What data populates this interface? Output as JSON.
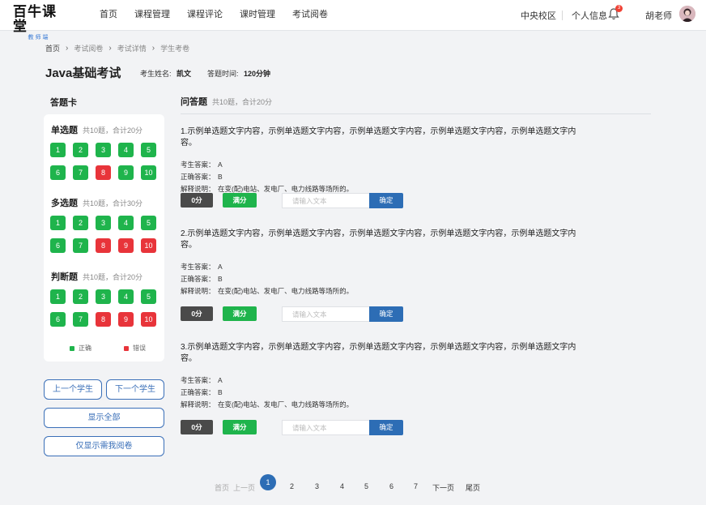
{
  "header": {
    "logo_main": "百牛课堂",
    "logo_sub": "教师端",
    "nav": [
      "首页",
      "课程管理",
      "课程评论",
      "课时管理",
      "考试阅卷"
    ],
    "campus": "中央校区",
    "profile": "个人信息",
    "notification_count": "3",
    "teacher": "胡老师"
  },
  "breadcrumb": [
    "首页",
    "考试阅卷",
    "考试详情",
    "学生考卷"
  ],
  "exam": {
    "title": "Java基础考试",
    "student_label": "考生姓名:",
    "student_name": "凯文",
    "time_label": "答题时间:",
    "time_value": "120分钟"
  },
  "answer_card": {
    "title": "答题卡",
    "sections": [
      {
        "title": "单选题",
        "summary": "共10题，合计20分",
        "items": [
          {
            "n": "1",
            "s": "ok"
          },
          {
            "n": "2",
            "s": "ok"
          },
          {
            "n": "3",
            "s": "ok"
          },
          {
            "n": "4",
            "s": "ok"
          },
          {
            "n": "5",
            "s": "ok"
          },
          {
            "n": "6",
            "s": "ok"
          },
          {
            "n": "7",
            "s": "ok"
          },
          {
            "n": "8",
            "s": "bad"
          },
          {
            "n": "9",
            "s": "ok"
          },
          {
            "n": "10",
            "s": "ok"
          }
        ]
      },
      {
        "title": "多选题",
        "summary": "共10题，合计30分",
        "items": [
          {
            "n": "1",
            "s": "ok"
          },
          {
            "n": "2",
            "s": "ok"
          },
          {
            "n": "3",
            "s": "ok"
          },
          {
            "n": "4",
            "s": "ok"
          },
          {
            "n": "5",
            "s": "ok"
          },
          {
            "n": "6",
            "s": "ok"
          },
          {
            "n": "7",
            "s": "ok"
          },
          {
            "n": "8",
            "s": "bad"
          },
          {
            "n": "9",
            "s": "bad"
          },
          {
            "n": "10",
            "s": "bad"
          }
        ]
      },
      {
        "title": "判断题",
        "summary": "共10题，合计20分",
        "items": [
          {
            "n": "1",
            "s": "ok"
          },
          {
            "n": "2",
            "s": "ok"
          },
          {
            "n": "3",
            "s": "ok"
          },
          {
            "n": "4",
            "s": "ok"
          },
          {
            "n": "5",
            "s": "ok"
          },
          {
            "n": "6",
            "s": "ok"
          },
          {
            "n": "7",
            "s": "ok"
          },
          {
            "n": "8",
            "s": "bad"
          },
          {
            "n": "9",
            "s": "bad"
          },
          {
            "n": "10",
            "s": "bad"
          }
        ]
      }
    ],
    "legend_correct": "正确",
    "legend_wrong": "错误"
  },
  "buttons": {
    "prev_student": "上一个学生",
    "next_student": "下一个学生",
    "show_all": "显示全部",
    "show_mine": "仅显示需我阅卷"
  },
  "section": {
    "title": "问答题",
    "summary": "共10题，合计20分"
  },
  "labels": {
    "student_answer": "考生答案：",
    "correct_answer": "正确答案：",
    "explanation": "解释说明：",
    "zero": "0分",
    "full": "满分",
    "input_placeholder": "请输入文本",
    "confirm": "确定"
  },
  "questions": [
    {
      "text": "1.示例单选题文字内容，示例单选题文字内容，示例单选题文字内容，示例单选题文字内容，示例单选题文字内容。",
      "student_answer": "A",
      "correct_answer": "B",
      "explanation": "在变(配)电站、发电厂、电力线路等场所的。"
    },
    {
      "text": "2.示例单选题文字内容，示例单选题文字内容，示例单选题文字内容，示例单选题文字内容，示例单选题文字内容。",
      "student_answer": "A",
      "correct_answer": "B",
      "explanation": "在变(配)电站、发电厂、电力线路等场所的。"
    },
    {
      "text": "3.示例单选题文字内容，示例单选题文字内容，示例单选题文字内容，示例单选题文字内容，示例单选题文字内容。",
      "student_answer": "A",
      "correct_answer": "B",
      "explanation": "在变(配)电站、发电厂、电力线路等场所的。"
    }
  ],
  "pagination": {
    "first": "首页",
    "prev": "上一页",
    "pages": [
      "1",
      "2",
      "3",
      "4",
      "5",
      "6",
      "7"
    ],
    "current": "1",
    "next": "下一页",
    "last": "尾页"
  },
  "colors": {
    "correct": "#1fb44c",
    "wrong": "#e8343a",
    "primary": "#2d6db5"
  }
}
